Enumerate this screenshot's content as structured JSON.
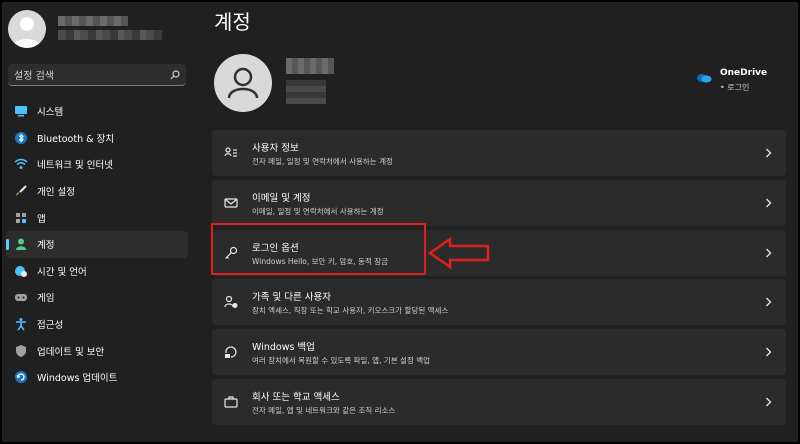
{
  "window": {
    "title": "계정"
  },
  "sidebar": {
    "search": {
      "placeholder": "설정 검색"
    },
    "items": [
      {
        "label": "시스템",
        "icon": "system-icon",
        "color": "#4cc2ff"
      },
      {
        "label": "Bluetooth & 장치",
        "icon": "bluetooth-icon",
        "color": "#4cc2ff"
      },
      {
        "label": "네트워크 및 인터넷",
        "icon": "wifi-icon",
        "color": "#4cc2ff"
      },
      {
        "label": "개인 설정",
        "icon": "brush-icon",
        "color": "#e8a25a"
      },
      {
        "label": "앱",
        "icon": "apps-icon",
        "color": "#a0a0a0"
      },
      {
        "label": "계정",
        "icon": "person-icon",
        "color": "#4ccf82",
        "active": true
      },
      {
        "label": "시간 및 언어",
        "icon": "globe-clock-icon",
        "color": "#4cc2ff"
      },
      {
        "label": "게임",
        "icon": "gamepad-icon",
        "color": "#a0a0a0"
      },
      {
        "label": "접근성",
        "icon": "accessibility-icon",
        "color": "#4cc2ff"
      },
      {
        "label": "업데이트 및 보안",
        "icon": "shield-icon",
        "color": "#a0a0a0"
      },
      {
        "label": "Windows 업데이트",
        "icon": "update-icon",
        "color": "#4cc2ff"
      }
    ]
  },
  "onedrive": {
    "title": "OneDrive",
    "status": "• 로그인",
    "icon": "onedrive-cloud-icon"
  },
  "cards": [
    {
      "title": "사용자 정보",
      "desc": "전자 메일, 일정 및 연락처에서 사용하는 계정",
      "icon": "user-info-icon"
    },
    {
      "title": "이메일 및 계정",
      "desc": "이메일, 일정 및 연락처에서 사용하는 계정",
      "icon": "mail-icon"
    },
    {
      "title": "로그인 옵션",
      "desc": "Windows Hello, 보안 키, 암호, 동적 잠금",
      "icon": "key-icon"
    },
    {
      "title": "가족 및 다른 사용자",
      "desc": "장치 액세스, 직장 또는 학교 사용자, 키오스크가 할당된 액세스",
      "icon": "family-icon"
    },
    {
      "title": "Windows 백업",
      "desc": "여러 장치에서 복원할 수 있도록 파일, 앱, 기본 설정 백업",
      "icon": "backup-icon"
    },
    {
      "title": "회사 또는 학교 액세스",
      "desc": "전자 메일, 앱 및 네트워크와 같은 조직 리소스",
      "icon": "briefcase-icon"
    }
  ],
  "annotation": {
    "color": "#e02020"
  },
  "colors": {
    "accent": "#60cdff",
    "background": "#202020",
    "card": "#2b2b2b"
  }
}
